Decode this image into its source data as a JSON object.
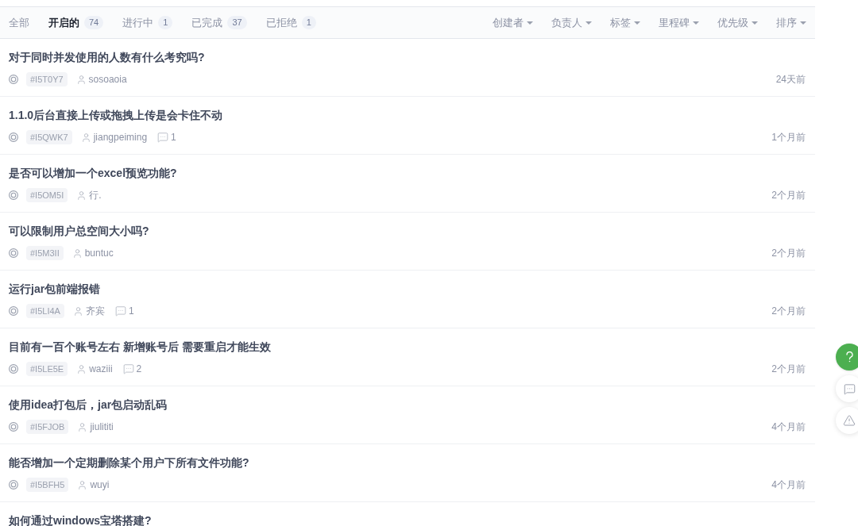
{
  "tabs": [
    {
      "label": "全部",
      "selected": false
    },
    {
      "label": "开启的",
      "count": "74",
      "selected": true
    },
    {
      "label": "进行中",
      "count": "1",
      "selected": false
    },
    {
      "label": "已完成",
      "count": "37",
      "selected": false
    },
    {
      "label": "已拒绝",
      "count": "1",
      "selected": false
    }
  ],
  "filters": [
    "创建者",
    "负责人",
    "标签",
    "里程碑",
    "优先级",
    "排序"
  ],
  "issues": [
    {
      "title": "对于同时并发使用的人数有什么考究吗?",
      "id": "#I5T0Y7",
      "author": "sosoaoia",
      "time": "24天前"
    },
    {
      "title": "1.1.0后台直接上传或拖拽上传是会卡住不动",
      "id": "#I5QWK7",
      "author": "jiangpeiming",
      "comments": "1",
      "time": "1个月前"
    },
    {
      "title": "是否可以增加一个excel预览功能?",
      "id": "#I5OM5I",
      "author": "行.",
      "time": "2个月前"
    },
    {
      "title": "可以限制用户总空间大小吗?",
      "id": "#I5M3II",
      "author": "buntuc",
      "time": "2个月前"
    },
    {
      "title": "运行jar包前端报错",
      "id": "#I5LI4A",
      "author": "齐宾",
      "comments": "1",
      "time": "2个月前"
    },
    {
      "title": "目前有一百个账号左右 新增账号后 需要重启才能生效",
      "id": "#I5LE5E",
      "author": "waziii",
      "comments": "2",
      "time": "2个月前"
    },
    {
      "title": "使用idea打包后，jar包启动乱码",
      "id": "#I5FJOB",
      "author": "jiulititi",
      "time": "4个月前"
    },
    {
      "title": "能否增加一个定期删除某个用户下所有文件功能?",
      "id": "#I5BFH5",
      "author": "wuyi",
      "time": "4个月前"
    },
    {
      "title": "如何通过windows宝塔搭建?"
    }
  ],
  "floating_buttons": [
    {
      "kind": "help"
    },
    {
      "kind": "comment"
    },
    {
      "kind": "warning"
    }
  ]
}
